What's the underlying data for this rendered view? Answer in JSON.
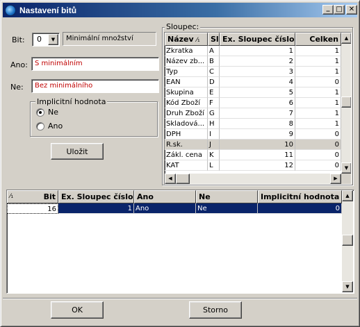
{
  "window": {
    "title": "Nastavení bitů",
    "minimize": "_",
    "maximize": "□",
    "close": "✕"
  },
  "form": {
    "bit_label": "Bit:",
    "bit_value": "0",
    "bit_name": "Minimální množství",
    "ano_label": "Ano:",
    "ano_value": "S minimálním",
    "ne_label": "Ne:",
    "ne_value": "Bez minimálního",
    "default_group": "Implicitní hodnota",
    "radio_ne": "Ne",
    "radio_ano": "Ano",
    "save": "Uložit"
  },
  "sloupec": {
    "label": "Sloupec:",
    "headers": [
      "Název",
      "Sl",
      "Ex. Sloupec číslo",
      "Celken"
    ],
    "sort_marker": "⁄₁",
    "rows": [
      [
        "Zkratka",
        "A",
        "1",
        "1"
      ],
      [
        "Název zb...",
        "B",
        "2",
        "1"
      ],
      [
        "Typ",
        "C",
        "3",
        "1"
      ],
      [
        "EAN",
        "D",
        "4",
        "0"
      ],
      [
        "Skupina",
        "E",
        "5",
        "1"
      ],
      [
        "Kód Zboží",
        "F",
        "6",
        "1"
      ],
      [
        "Druh Zboží",
        "G",
        "7",
        "1"
      ],
      [
        "Skladová...",
        "H",
        "8",
        "1"
      ],
      [
        "DPH",
        "I",
        "9",
        "0"
      ],
      [
        "R.sk.",
        "J",
        "10",
        "0"
      ],
      [
        "Zákl. cena",
        "K",
        "11",
        "0"
      ],
      [
        "KAT",
        "L",
        "12",
        "0"
      ]
    ],
    "selected_row": 9
  },
  "bits_table": {
    "headers": [
      "Bit",
      "Ex. Sloupec číslo",
      "Ano",
      "Ne",
      "Implicitní hodnota"
    ],
    "sort_marker": "⁄₁",
    "rows": [
      [
        "16",
        "1",
        "Ano",
        "Ne",
        "0"
      ]
    ]
  },
  "footer": {
    "ok": "OK",
    "cancel": "Storno"
  },
  "colors": {
    "title_start": "#0a246a",
    "title_end": "#a6caf0",
    "selection": "#0a246a",
    "red_text": "#c00000"
  }
}
